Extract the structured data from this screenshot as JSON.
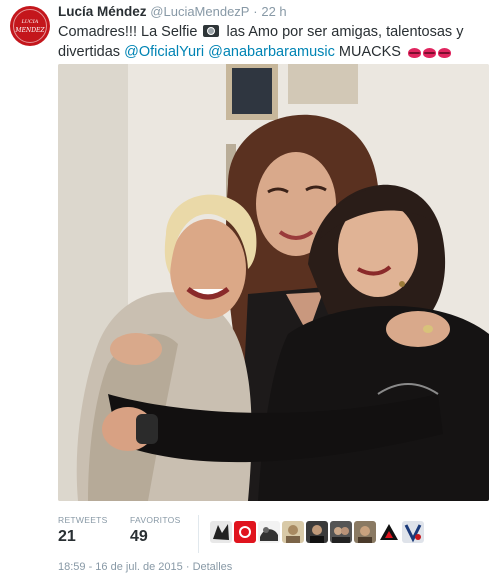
{
  "author": {
    "name": "Lucía Méndez",
    "screen_name": "@LuciaMendezP",
    "separator": "·",
    "time_ago": "22 h",
    "avatar_text": "LUCIA MENDEZ"
  },
  "tweet": {
    "part1": "Comadres!!! La Selfie",
    "part2": "las Amo por ser amigas, talentosas y divertidas",
    "mention1": "@OficialYuri",
    "mention2": "@anabarbaramusic",
    "part3": "MUACKS"
  },
  "stats": {
    "retweets_label": "RETWEETS",
    "retweets_value": "21",
    "favorites_label": "FAVORITOS",
    "favorites_value": "49"
  },
  "favoriters": [
    {
      "icon": "avatar-icon"
    },
    {
      "icon": "avatar-icon"
    },
    {
      "icon": "avatar-icon"
    },
    {
      "icon": "avatar-icon"
    },
    {
      "icon": "avatar-icon"
    },
    {
      "icon": "avatar-icon"
    },
    {
      "icon": "avatar-icon"
    },
    {
      "icon": "avatar-icon"
    },
    {
      "icon": "avatar-icon"
    }
  ],
  "footer": {
    "timestamp": "18:59 - 16 de jul. de 2015",
    "separator": "·",
    "details_link": "Detalles"
  },
  "colors": {
    "link": "#0084b4",
    "muted": "#8899a6",
    "text": "#292f33",
    "brand_red": "#c4161c",
    "kiss_red": "#e0245e"
  }
}
